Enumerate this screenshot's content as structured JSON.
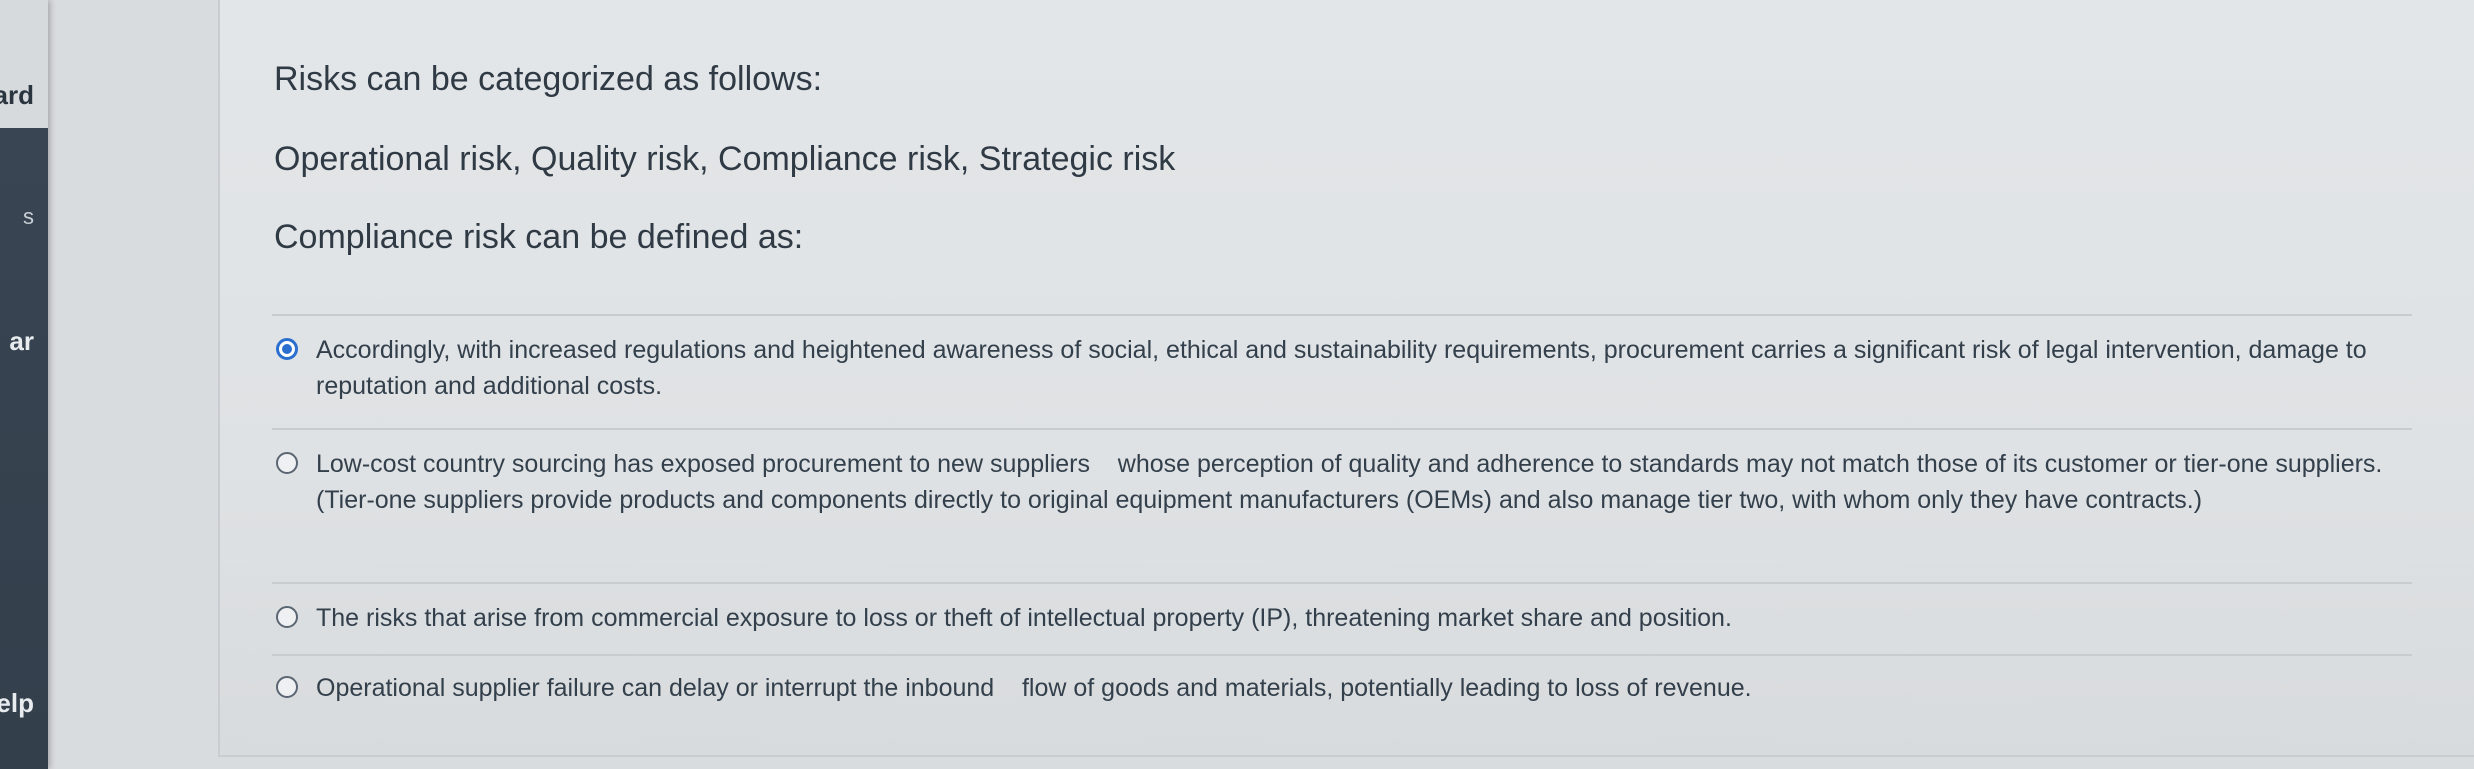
{
  "sidebar": {
    "items": [
      {
        "label": "ard"
      },
      {
        "label": "s"
      },
      {
        "label": "ar"
      },
      {
        "label": "elp"
      }
    ]
  },
  "question": {
    "intro": "Risks can be categorized as follows:",
    "categories": "Operational risk, Quality risk, Compliance risk, Strategic risk",
    "prompt": "Compliance risk can be defined as:"
  },
  "options": [
    {
      "text": "Accordingly, with increased regulations and heightened awareness of social, ethical and sustainability requirements, procurement carries a significant risk of legal intervention, damage to reputation and additional costs.",
      "selected": true
    },
    {
      "text": "Low-cost country sourcing has exposed procurement to new suppliers    whose perception of quality and adherence to standards may not match those of its customer or tier-one suppliers. (Tier-one suppliers provide products and components directly to original equipment manufacturers (OEMs) and also manage tier two, with whom only they have contracts.)",
      "selected": false
    },
    {
      "text": "The risks that arise from commercial exposure to loss or theft of intellectual property (IP), threatening market share and position.",
      "selected": false
    },
    {
      "text": "Operational supplier failure can delay or interrupt the inbound    flow of goods and materials, potentially leading to loss of revenue.",
      "selected": false
    }
  ],
  "colors": {
    "accent": "#2a6ecf",
    "sidebar": "#38444f",
    "panel": "#e1e4e6"
  }
}
